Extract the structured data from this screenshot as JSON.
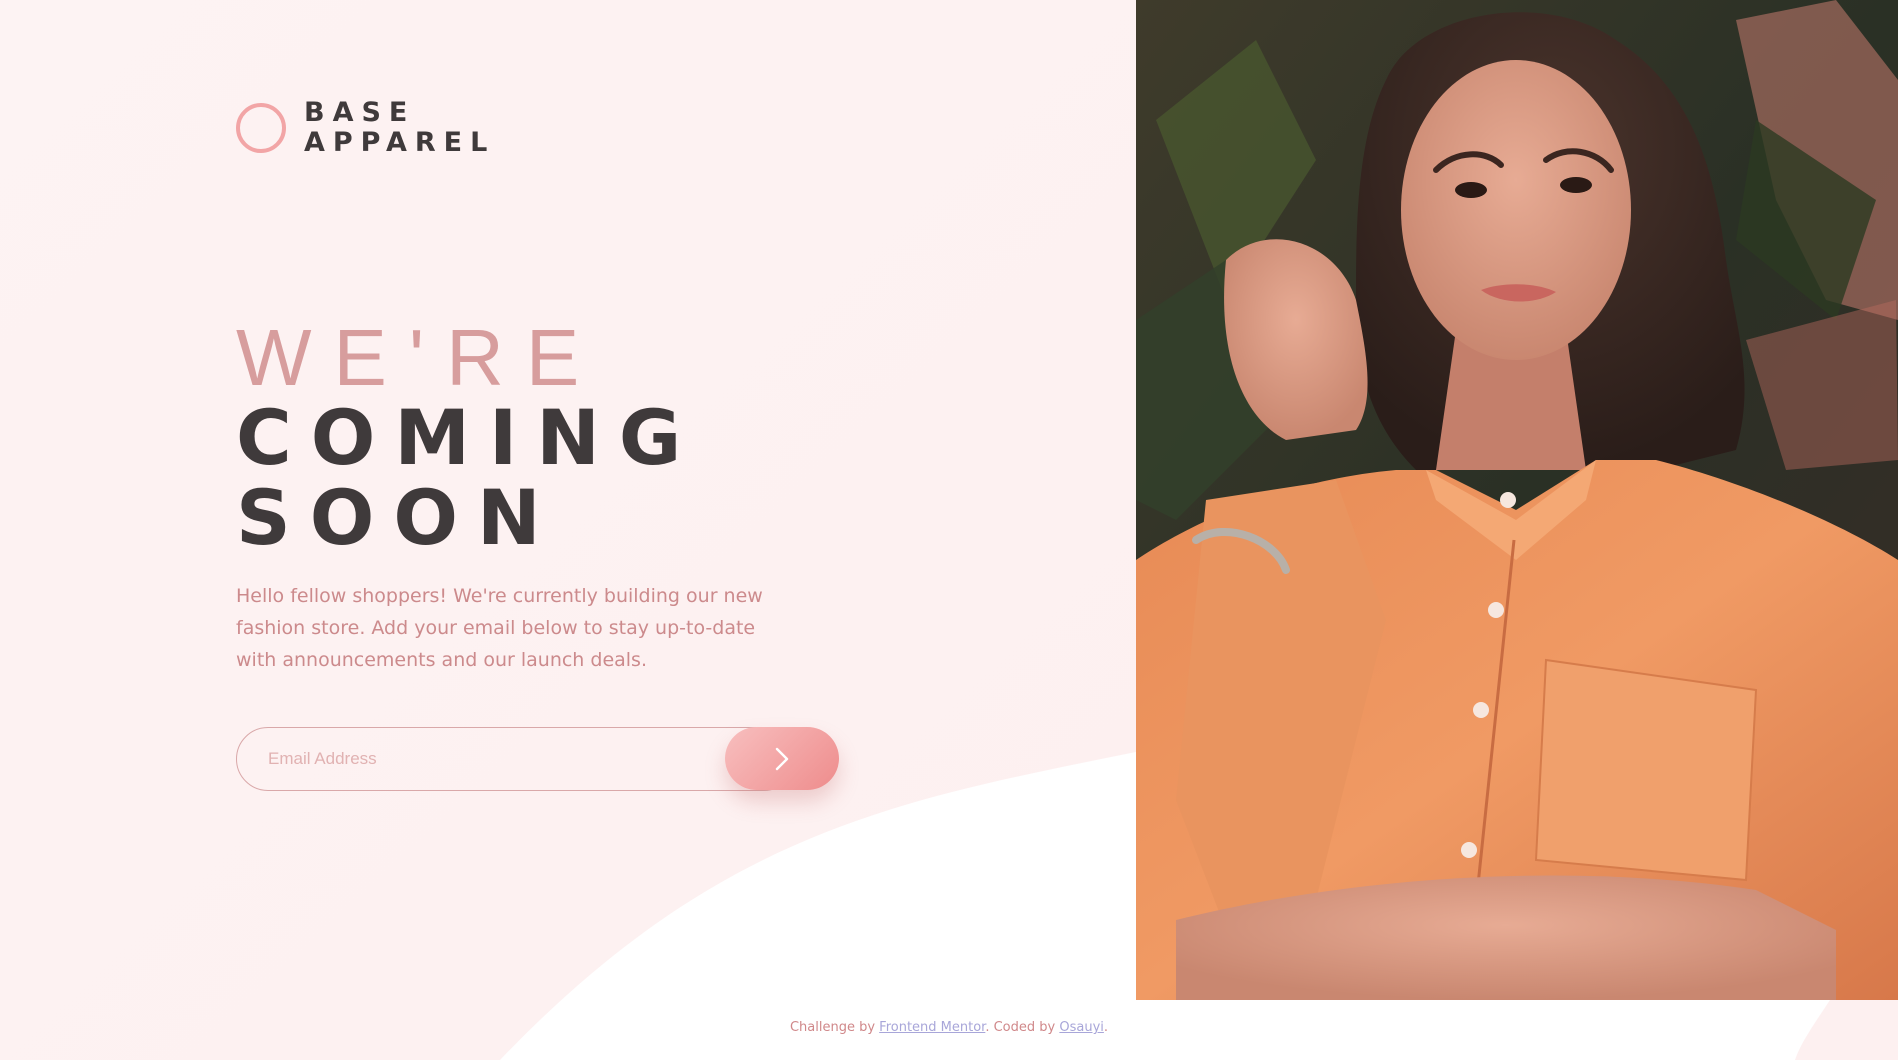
{
  "brand": {
    "line1": "BASE",
    "line2": "APPAREL"
  },
  "headline": {
    "light": "WE'RE",
    "bold1": "COMING",
    "bold2": "SOON"
  },
  "intro": "Hello fellow shoppers! We're currently building our new fashion store. Add your email below to stay up-to-date with announcements and our launch deals.",
  "form": {
    "email_placeholder": "Email Address",
    "submit_icon": "chevron-right-icon"
  },
  "footer": {
    "prefix": "Challenge by ",
    "link1": "Frontend Mentor",
    "middle": ". Coded by ",
    "link2": "Osauyi",
    "suffix": "."
  },
  "colors": {
    "accent": "#f2a5a6",
    "text_dark": "#3f3a3b",
    "text_pink": "#cc8a8c",
    "link": "#a8a6d9"
  }
}
